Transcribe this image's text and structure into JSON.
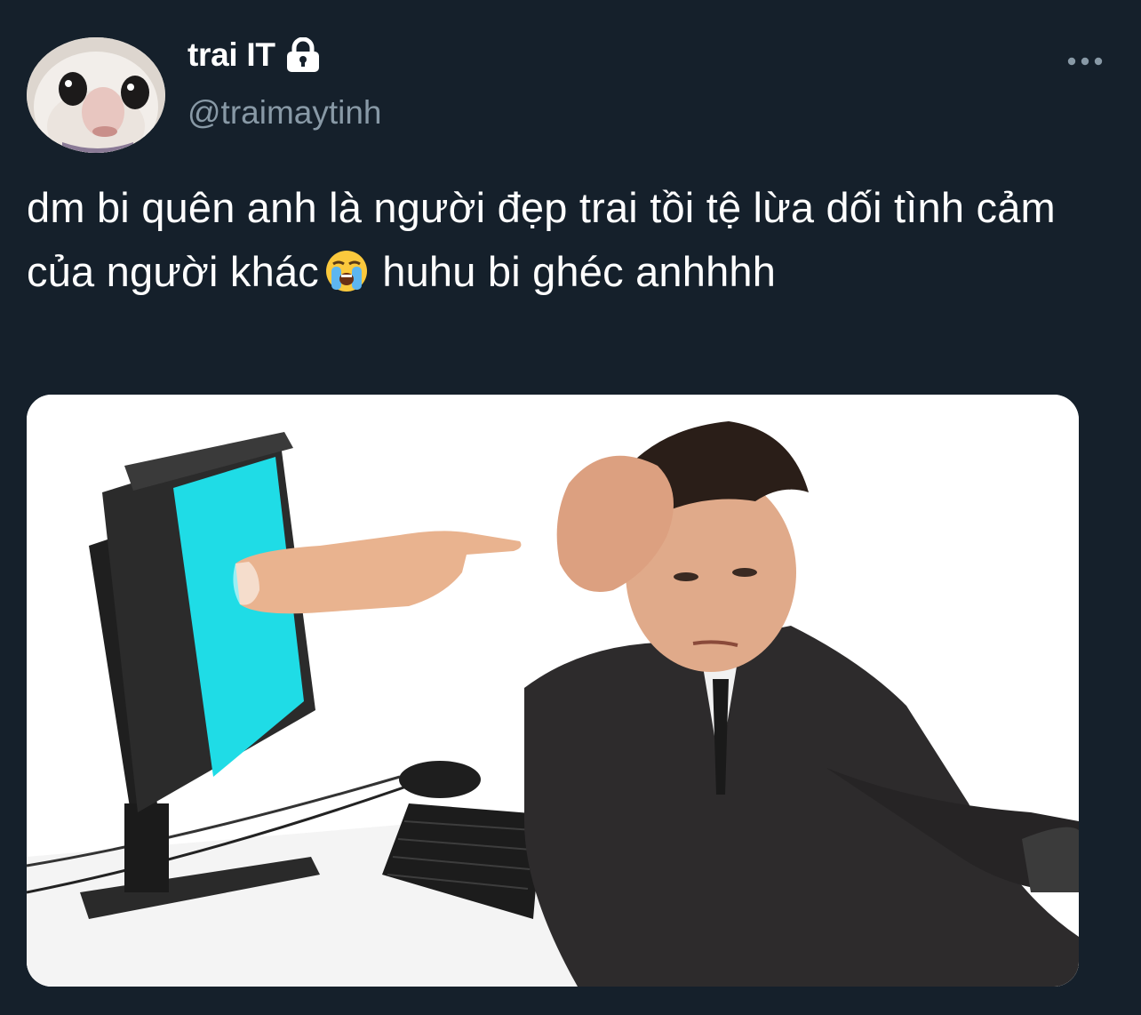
{
  "author": {
    "display_name": "trai IT",
    "handle": "@traimaytinh",
    "protected": true,
    "avatar_icon": "rat-face-avatar"
  },
  "tweet": {
    "text_part1": "dm bi quên anh là người đẹp trai tồi tệ lừa dối tình cảm của người khác",
    "emoji": "loudly-crying-face-icon",
    "text_part2": " huhu bi ghéc anhhhh"
  },
  "media": {
    "type": "image",
    "subject": "man-at-computer-pointing-hand-meme"
  },
  "colors": {
    "background": "#15202b",
    "primary_text": "#ffffff",
    "secondary_text": "#8899a6"
  }
}
